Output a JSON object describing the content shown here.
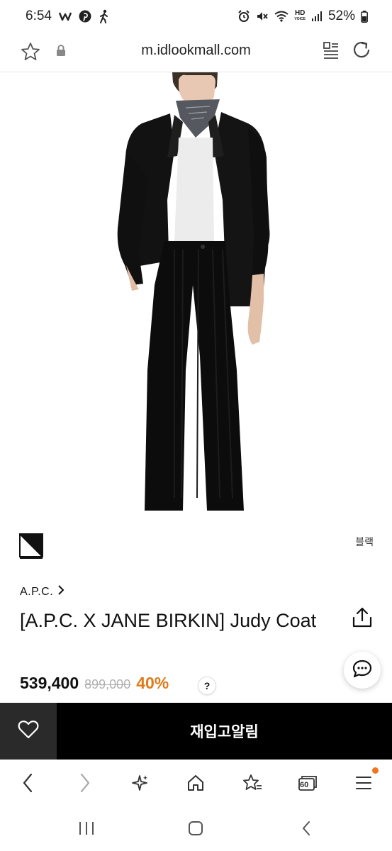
{
  "status_bar": {
    "time": "6:54",
    "battery": "52%",
    "icons": [
      "w-icon",
      "pinterest-icon",
      "walking-icon",
      "alarm-icon",
      "mute-icon",
      "wifi-icon",
      "hd-voice-icon",
      "signal-icon",
      "battery-icon"
    ],
    "hd_label": "HD"
  },
  "browser": {
    "url": "m.idlookmall.com"
  },
  "product": {
    "color_label": "블랙",
    "brand": "A.P.C.",
    "title": "[A.P.C. X JANE BIRKIN] Judy Coat",
    "price": "539,400",
    "original_price": "899,000",
    "discount": "40%",
    "info_label": "?"
  },
  "actions": {
    "restock_label": "재입고알림"
  },
  "browser_nav": {
    "tabs_count": "60"
  },
  "colors": {
    "discount": "#e07a1a",
    "action_bar": "#000000",
    "wish_bg": "#2a2a2a",
    "badge": "#f4731f"
  }
}
